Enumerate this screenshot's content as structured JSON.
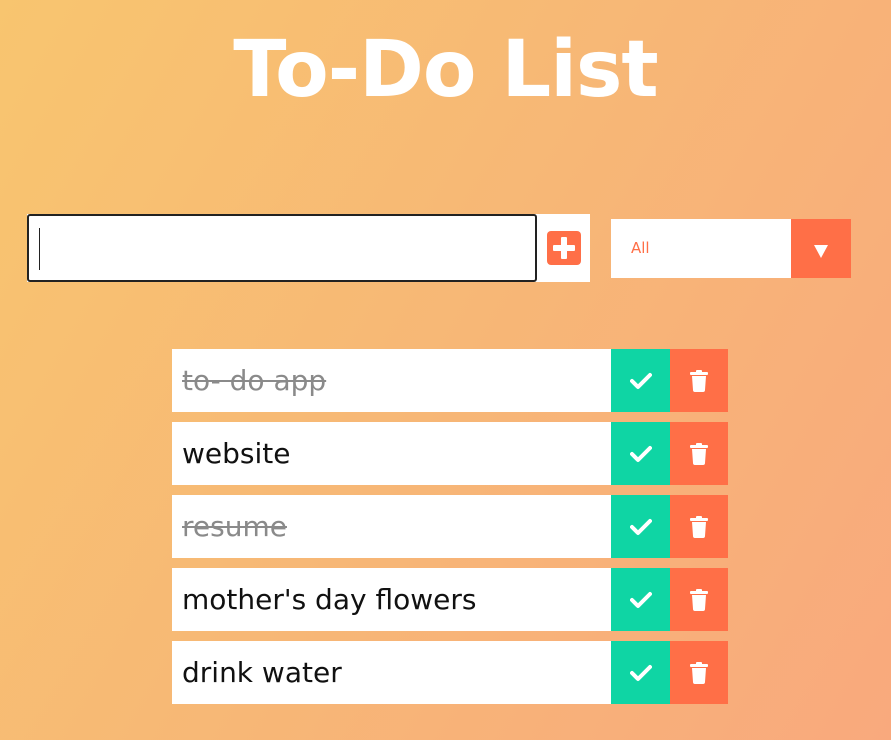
{
  "header": {
    "title": "To-Do List"
  },
  "form": {
    "input_value": "",
    "add_icon": "plus-square-icon",
    "filter_selected": "All",
    "filter_icon": "caret-down-icon"
  },
  "todos": [
    {
      "text": "to- do app",
      "completed": true
    },
    {
      "text": "website",
      "completed": false
    },
    {
      "text": "resume",
      "completed": true
    },
    {
      "text": "mother's day flowers",
      "completed": false
    },
    {
      "text": "drink water",
      "completed": false
    }
  ],
  "icons": {
    "complete": "check-icon",
    "delete": "trash-icon"
  },
  "colors": {
    "accent": "#ff6f47",
    "check": "#0fd5a4",
    "background_start": "#f8c56f",
    "background_end": "#f9a97d"
  }
}
